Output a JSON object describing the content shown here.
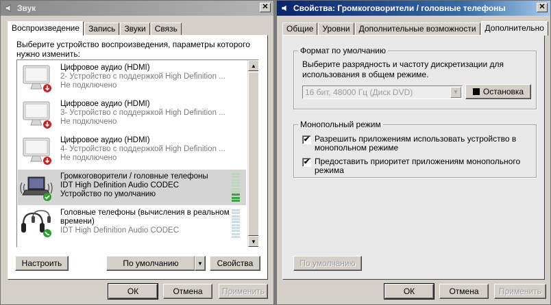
{
  "sound_window": {
    "title": "Звук",
    "tabs": [
      "Воспроизведение",
      "Запись",
      "Звуки",
      "Связь"
    ],
    "description": "Выберите устройство воспроизведения, параметры которого нужно изменить:",
    "devices": [
      {
        "name": "Цифровое аудио (HDMI)",
        "line2": "2- Устройство с поддержкой High Definition ...",
        "line3": "Не подключено",
        "icon": "monitor-icon",
        "status_icon": "disconnected-arrow-icon",
        "selected": false
      },
      {
        "name": "Цифровое аудио (HDMI)",
        "line2": "3- Устройство с поддержкой High Definition ...",
        "line3": "Не подключено",
        "icon": "monitor-icon",
        "status_icon": "disconnected-arrow-icon",
        "selected": false
      },
      {
        "name": "Цифровое аудио (HDMI)",
        "line2": "4- Устройство с поддержкой High Definition ...",
        "line3": "Не подключено",
        "icon": "monitor-icon",
        "status_icon": "disconnected-arrow-icon",
        "selected": false
      },
      {
        "name": "Громкоговорители / головные телефоны",
        "line2": "IDT High Definition Audio CODEC",
        "line3": "Устройство по умолчанию",
        "icon": "laptop-speakers-icon",
        "status_icon": "default-check-icon",
        "selected": true
      },
      {
        "name": "Головные телефоны (вычисления в реальном",
        "line2": "времени)",
        "line3": "IDT High Definition Audio CODEC",
        "icon": "headphones-icon",
        "status_icon": "communication-phone-icon",
        "selected": false
      }
    ],
    "buttons": {
      "configure": "Настроить",
      "set_default": "По умолчанию",
      "properties": "Свойства",
      "ok": "ОК",
      "cancel": "Отмена",
      "apply": "Применить"
    }
  },
  "props_window": {
    "title": "Свойства: Громкоговорители / головные телефоны",
    "tabs": [
      "Общие",
      "Уровни",
      "Дополнительные возможности",
      "Дополнительно"
    ],
    "default_format": {
      "group_title": "Формат по умолчанию",
      "description": "Выберите разрядность и частоту дискретизации для использования в общем режиме.",
      "combo_value": "16 бит, 48000 Гц (Диск DVD)",
      "test_button": "Остановка"
    },
    "exclusive_mode": {
      "group_title": "Монопольный режим",
      "options": [
        {
          "label": "Разрешить приложениям использовать устройство в монопольном режиме",
          "checked": true
        },
        {
          "label": "Предоставить приоритет приложениям монопольного режима",
          "checked": true
        }
      ]
    },
    "buttons": {
      "restore_defaults": "По умолчанию",
      "ok": "ОК",
      "cancel": "Отмена",
      "apply": "Применить"
    }
  },
  "colors": {
    "active_title": "#0a246a",
    "meter_active": "#3fa04a",
    "default_check": "#2ca02c",
    "disconnected": "#cc2222"
  },
  "meter_levels": {
    "device_4_active_bars": 3
  }
}
